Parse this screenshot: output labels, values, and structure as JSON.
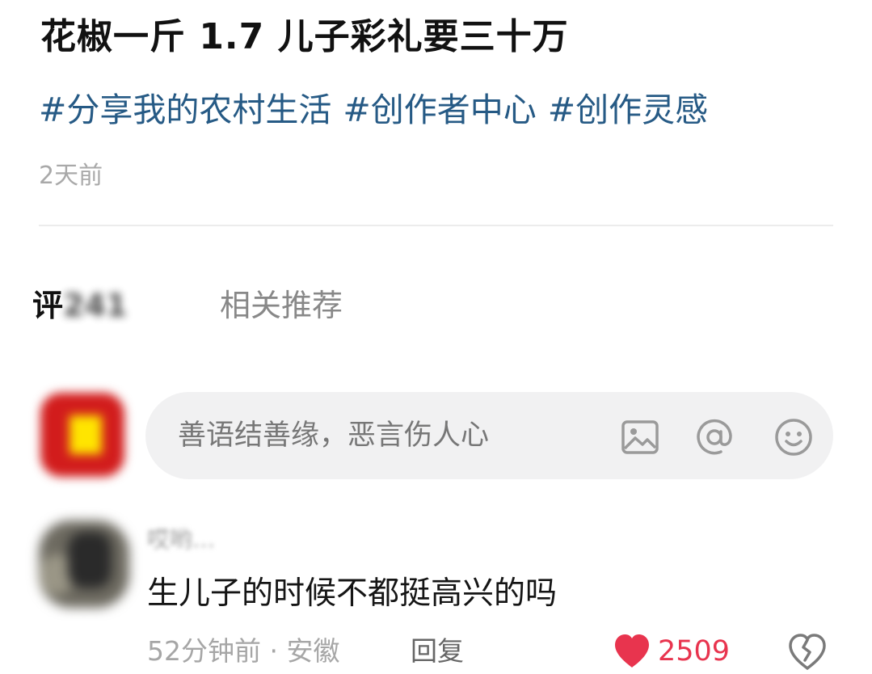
{
  "post": {
    "title": "花椒一斤 1.7  儿子彩礼要三十万",
    "tags": [
      "#分享我的农村生活",
      "#创作者中心",
      "#创作灵感"
    ],
    "time": "2天前"
  },
  "tabs": {
    "comments_prefix": "评",
    "comments_count": "241",
    "related": "相关推荐"
  },
  "comment_input": {
    "placeholder": "善语结善缘，恶言伤人心",
    "icons": [
      "image-icon",
      "at-icon",
      "emoji-icon"
    ]
  },
  "comments": [
    {
      "username": "哎哟…",
      "text": "生儿子的时候不都挺高兴的吗",
      "meta": "52分钟前 · 安徽",
      "reply_label": "回复",
      "likes": "2509",
      "liked": true
    }
  ],
  "colors": {
    "tag": "#265a85",
    "like": "#e8344e",
    "muted": "#a6a6a6"
  }
}
